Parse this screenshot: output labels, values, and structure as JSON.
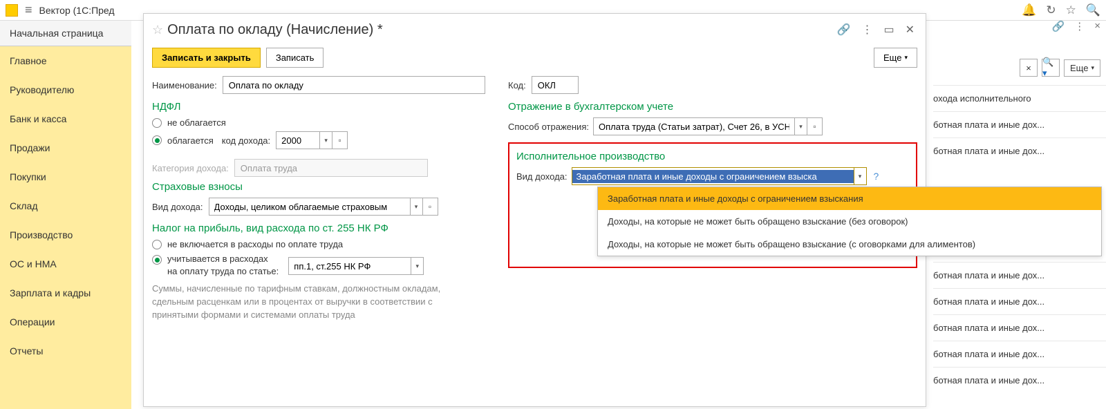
{
  "app": {
    "title": "Вектор  (1С:Пред"
  },
  "topbar_icons": {
    "bell": "🔔",
    "history": "⟳",
    "star": "☆",
    "search": "🔍"
  },
  "sidebar": {
    "home": "Начальная страница",
    "items": [
      "Главное",
      "Руководителю",
      "Банк и касса",
      "Продажи",
      "Покупки",
      "Склад",
      "Производство",
      "ОС и НМА",
      "Зарплата и кадры",
      "Операции",
      "Отчеты"
    ]
  },
  "dialog": {
    "title": "Оплата по окладу (Начисление) *",
    "btn_save_close": "Записать и закрыть",
    "btn_save": "Записать",
    "btn_more": "Еще",
    "name_label": "Наименование:",
    "name_value": "Оплата по окладу",
    "code_label": "Код:",
    "code_value": "ОКЛ"
  },
  "ndfl": {
    "title": "НДФЛ",
    "opt_no": "не облагается",
    "opt_yes": "облагается",
    "code_label": "код дохода:",
    "code_value": "2000",
    "cat_label": "Категория дохода:",
    "cat_value": "Оплата труда"
  },
  "strah": {
    "title": "Страховые взносы",
    "vid_label": "Вид дохода:",
    "vid_value": "Доходы, целиком облагаемые страховым"
  },
  "nalog": {
    "title": "Налог на прибыль, вид расхода по ст. 255 НК РФ",
    "opt_no": "не включается в расходы по оплате труда",
    "opt_yes_line1": "учитывается в расходах",
    "opt_yes_line2": "на оплату труда по статье:",
    "article_value": "пп.1, ст.255 НК РФ",
    "hint": "Суммы, начисленные по тарифным ставкам, должностным окладам, сдельным расценкам или в процентах от выручки в соответствии с принятыми формами и системами оплаты труда"
  },
  "reflect": {
    "title": "Отражение в бухгалтерском учете",
    "label": "Способ отражения:",
    "value": "Оплата труда (Статьи затрат), Счет 26, в УСН п"
  },
  "ispol": {
    "title": "Исполнительное производство",
    "label": "Вид дохода:",
    "selected": "Заработная плата и иные доходы с ограничением взыска",
    "help": "?",
    "options": [
      "Заработная плата и иные доходы с ограничением взыскания",
      "Доходы, на которые не может быть обращено взыскание (без оговорок)",
      "Доходы, на которые не может быть обращено взыскание (с оговорками для алиментов)"
    ]
  },
  "bg": {
    "btn_more": "Еще",
    "close": "×",
    "rows": [
      "охода исполнительного ",
      "ботная плата и иные дох...",
      "ботная плата и иные дох...",
      "ботная плата и иные дох...",
      "ботная плата и иные дох...",
      "ботная плата и иные дох...",
      "ботная плата и иные дох...",
      "ботная плата и иные дох..."
    ]
  }
}
